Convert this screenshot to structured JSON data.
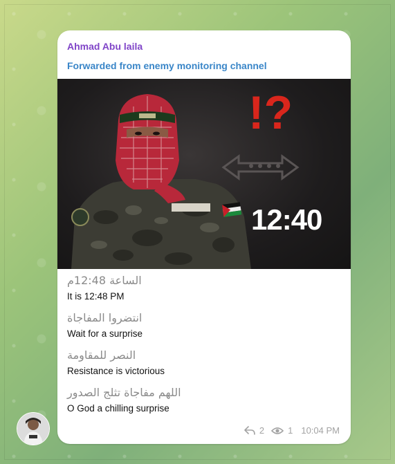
{
  "message": {
    "sender_name": "Ahmad Abu laila",
    "forwarded_from": "Forwarded from enemy monitoring channel",
    "image": {
      "overlay_time": "12:40",
      "overlay_marks": "!?"
    },
    "caption": [
      {
        "arabic": "الساعة 12:48م",
        "english": "It is 12:48 PM"
      },
      {
        "arabic": "انتضروا المفاجاة",
        "english": "Wait for a surprise"
      },
      {
        "arabic": "النصر للمقاومة",
        "english": "Resistance is victorious"
      },
      {
        "arabic": "اللهم مفاجاة تثلج الصدور",
        "english": "O God a chilling surprise"
      }
    ],
    "replies_count": "2",
    "views_count": "1",
    "time": "10:04 PM"
  },
  "icons": {
    "reply": "reply-arrow-icon",
    "views": "eye-icon"
  },
  "colors": {
    "sender": "#8045c8",
    "forwarded": "#3a86c8",
    "overlay_marks": "#d9261c",
    "meta_text": "#a3a3a3"
  }
}
